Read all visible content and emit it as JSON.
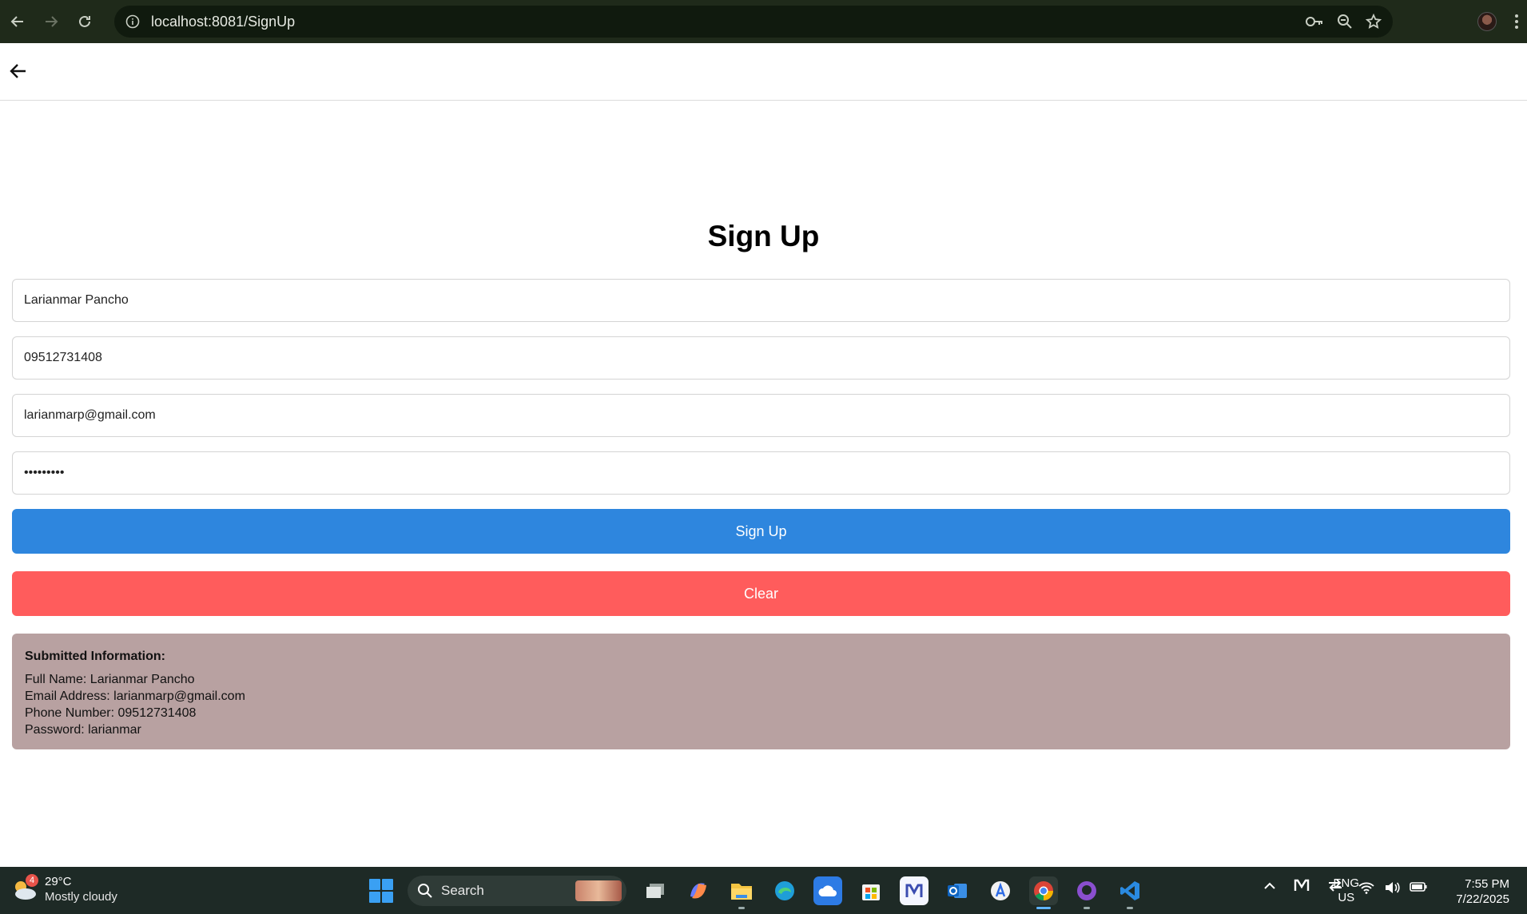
{
  "browser": {
    "url_host": "localhost",
    "url_path": ":8081/SignUp",
    "icons": [
      "back-icon",
      "forward-icon",
      "reload-icon",
      "site-info-icon",
      "password-key-icon",
      "zoom-icon",
      "bookmark-star-icon",
      "profile-avatar",
      "menu-icon"
    ]
  },
  "page": {
    "title": "Sign Up",
    "fields": {
      "full_name": "Larianmar Pancho",
      "phone": "09512731408",
      "email": "larianmarp@gmail.com",
      "password_masked": "•••••••••"
    },
    "signup_label": "Sign Up",
    "clear_label": "Clear",
    "submitted": {
      "heading": "Submitted Information:",
      "full_name": "Full Name: Larianmar Pancho",
      "email": "Email Address: larianmarp@gmail.com",
      "phone": "Phone Number: 09512731408",
      "password": "Password: larianmar"
    },
    "colors": {
      "signup": "#2e86de",
      "clear": "#ff5c5c",
      "info_box": "#b8a1a1"
    }
  },
  "taskbar": {
    "weather_badge": "4",
    "temperature": "29°C",
    "condition": "Mostly cloudy",
    "search_label": "Search",
    "lang_top": "ENG",
    "lang_bottom": "US",
    "time": "7:55 PM",
    "date": "7/22/2025"
  }
}
